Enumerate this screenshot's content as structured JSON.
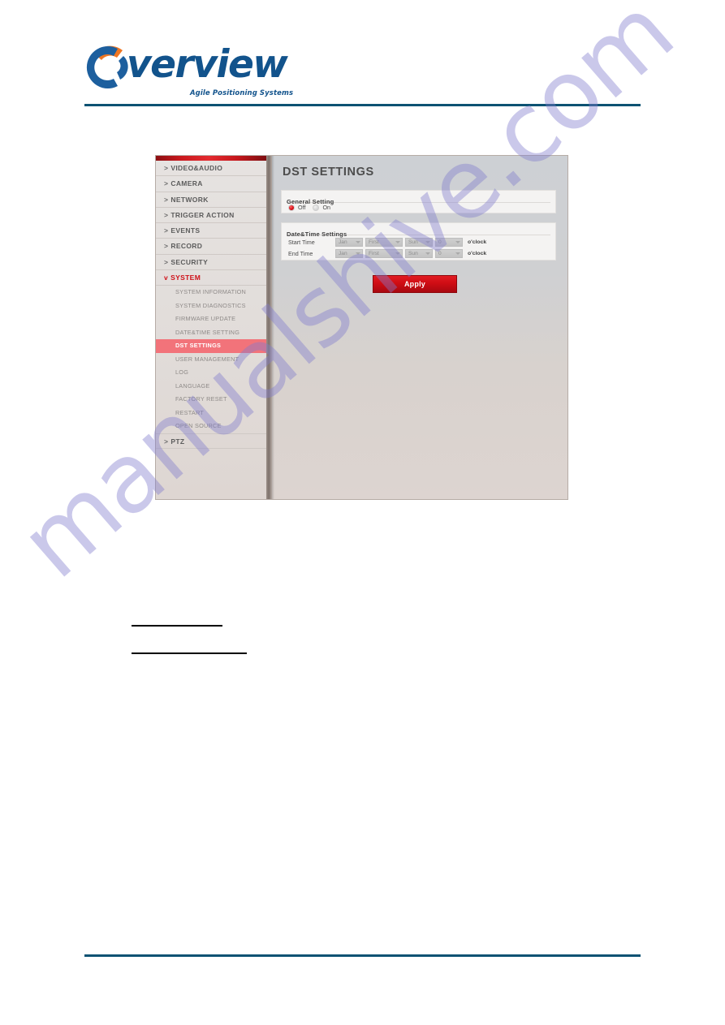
{
  "document": {
    "logo": {
      "mark": "overview-circle-logo",
      "wordmark": "verview",
      "tagline": "Agile Positioning Systems",
      "brand_blue": "#12538c",
      "brand_orange": "#ef7622"
    },
    "rule_color": "#0d5273",
    "watermark": "manualshive.com",
    "redacted_lines": 2
  },
  "screenshot": {
    "sidebar": {
      "accent_bar_color": "#c8181d",
      "top_items": [
        {
          "chevron": ">",
          "label": "VIDEO&AUDIO",
          "active": false
        },
        {
          "chevron": ">",
          "label": "CAMERA",
          "active": false
        },
        {
          "chevron": ">",
          "label": "NETWORK",
          "active": false
        },
        {
          "chevron": ">",
          "label": "TRIGGER ACTION",
          "active": false
        },
        {
          "chevron": ">",
          "label": "EVENTS",
          "active": false
        },
        {
          "chevron": ">",
          "label": "RECORD",
          "active": false
        },
        {
          "chevron": ">",
          "label": "SECURITY",
          "active": false
        },
        {
          "chevron": "v",
          "label": "SYSTEM",
          "active": true
        }
      ],
      "sub_items": [
        {
          "label": "SYSTEM INFORMATION",
          "selected": false
        },
        {
          "label": "SYSTEM DIAGNOSTICS",
          "selected": false
        },
        {
          "label": "FIRMWARE UPDATE",
          "selected": false
        },
        {
          "label": "DATE&TIME SETTING",
          "selected": false
        },
        {
          "label": "DST SETTINGS",
          "selected": true
        },
        {
          "label": "USER MANAGEMENT",
          "selected": false
        },
        {
          "label": "LOG",
          "selected": false
        },
        {
          "label": "LANGUAGE",
          "selected": false
        },
        {
          "label": "FACTORY RESET",
          "selected": false
        },
        {
          "label": "RESTART",
          "selected": false
        },
        {
          "label": "OPEN SOURCE",
          "selected": false
        }
      ],
      "bottom_items": [
        {
          "chevron": ">",
          "label": "PTZ",
          "active": false
        }
      ],
      "selected_color": "#f2737a",
      "active_color": "#cf1018"
    },
    "panel": {
      "title": "DST SETTINGS",
      "general": {
        "heading": "General Setting",
        "options": [
          {
            "label": "Off",
            "selected": true
          },
          {
            "label": "On",
            "selected": false
          }
        ]
      },
      "datetime": {
        "heading": "Date&Time Settings",
        "rows": [
          {
            "label": "Start Time",
            "month": "Jan",
            "week": "First",
            "day": "Sun",
            "hour": "0",
            "suffix": "o'clock"
          },
          {
            "label": "End Time",
            "month": "Jan",
            "week": "First",
            "day": "Sun",
            "hour": "0",
            "suffix": "o'clock"
          }
        ]
      },
      "apply_label": "Apply",
      "apply_color": "#cf0d14"
    }
  }
}
